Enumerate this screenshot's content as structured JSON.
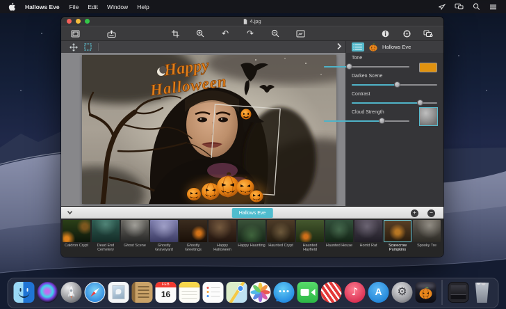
{
  "colors": {
    "accent_teal": "#52b8ca",
    "panel_bg": "#353538",
    "toolbar_bg": "#3b3b3d",
    "tone_swatch": "#e0920f"
  },
  "menu_bar": {
    "app_name": "Hallows Eve",
    "items": [
      "File",
      "Edit",
      "Window",
      "Help"
    ],
    "status_icons": [
      "cursor-arrow-icon",
      "displays-icon",
      "spotlight-icon",
      "notification-center-icon"
    ]
  },
  "window": {
    "title": "4.jpg",
    "toolbar_icons_left": [
      "open-image",
      "save-export"
    ],
    "toolbar_icons_center": [
      "crop",
      "zoom-in",
      "undo",
      "redo",
      "zoom-out",
      "fit-image"
    ],
    "toolbar_icons_right": [
      "info",
      "settings",
      "effects"
    ],
    "tools": [
      "move-tool",
      "marquee-select-tool"
    ],
    "undo_glyph": "↶",
    "redo_glyph": "↷"
  },
  "canvas": {
    "overlay_line1": "Happy",
    "overlay_line2": "Halloween"
  },
  "panel": {
    "title": "Hallows Eve",
    "sliders": [
      {
        "label": "Tone",
        "value_pct": 30,
        "swatch_color": "#e0920f"
      },
      {
        "label": "Darken Scene",
        "value_pct": 53
      },
      {
        "label": "Contrast",
        "value_pct": 80
      },
      {
        "label": "Cloud Strength",
        "value_pct": 68,
        "swatch": "cloud-texture"
      }
    ]
  },
  "filmstrip": {
    "collection_label": "Hallows Eve",
    "add_label": "+",
    "remove_label": "−",
    "thumbnails": [
      {
        "name": "Caldron Crypt"
      },
      {
        "name": "Dead End Cemetery"
      },
      {
        "name": "Ghost Scene"
      },
      {
        "name": "Ghostly Graveyard"
      },
      {
        "name": "Ghostly Greetings"
      },
      {
        "name": "Happy Halloween"
      },
      {
        "name": "Happy Haunting"
      },
      {
        "name": "Haunted Crypt"
      },
      {
        "name": "Haunted Hayfield"
      },
      {
        "name": "Haunted House"
      },
      {
        "name": "Horrid Rat"
      },
      {
        "name": "Scarecrow Pumpkins",
        "selected": true
      },
      {
        "name": "Spooky Tre"
      }
    ]
  },
  "dock": {
    "calendar_month": "FEB",
    "calendar_day": "16",
    "music_glyph": "♪",
    "appstore_glyph": "A",
    "prefs_glyph": "⚙",
    "apps": [
      "Finder",
      "Siri",
      "Launchpad",
      "Safari",
      "Mail",
      "Contacts",
      "Calendar",
      "Notes",
      "Reminders",
      "Maps",
      "Photos",
      "Messages",
      "FaceTime",
      "News",
      "Music",
      "App Store",
      "System Preferences",
      "Hallows Eve",
      "Downloads",
      "Trash"
    ],
    "running_apps": [
      "Finder",
      "Hallows Eve"
    ]
  }
}
